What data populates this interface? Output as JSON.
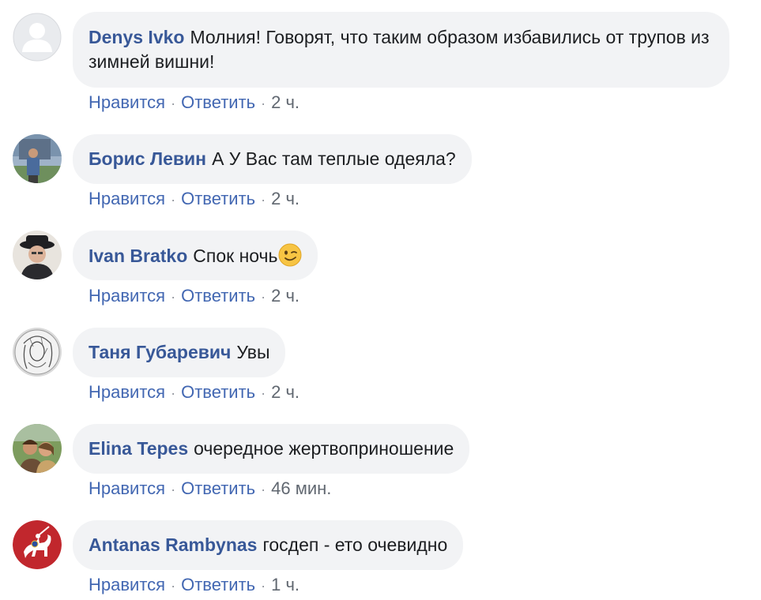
{
  "actions": {
    "like": "Нравится",
    "reply": "Ответить",
    "sep": "·"
  },
  "comments": [
    {
      "author": "Denys Ivko",
      "text": "Молния! Говорят, что таким образом избавились от трупов из зимней вишни!",
      "time": "2 ч.",
      "avatar": "default-avatar-icon"
    },
    {
      "author": "Борис Левин",
      "text": "А У Вас там теплые одеяла?",
      "time": "2 ч.",
      "avatar": "photo-man-in-front-of-building"
    },
    {
      "author": "Ivan Bratko",
      "text": "Спок ночь",
      "emoji": "winking-face-icon",
      "time": "2 ч.",
      "avatar": "photo-man-in-black-hat"
    },
    {
      "author": "Таня Губаревич",
      "text": "Увы",
      "time": "2 ч.",
      "avatar": "sketch-portrait"
    },
    {
      "author": "Elina Tepes",
      "text": "очередное жертвоприношение",
      "time": "46 мин.",
      "avatar": "photo-couple-outdoors"
    },
    {
      "author": "Antanas Rambynas",
      "text": "госдеп - ето очевидно",
      "time": "1 ч.",
      "avatar": "lithuanian-vytis-coat-of-arms"
    }
  ]
}
